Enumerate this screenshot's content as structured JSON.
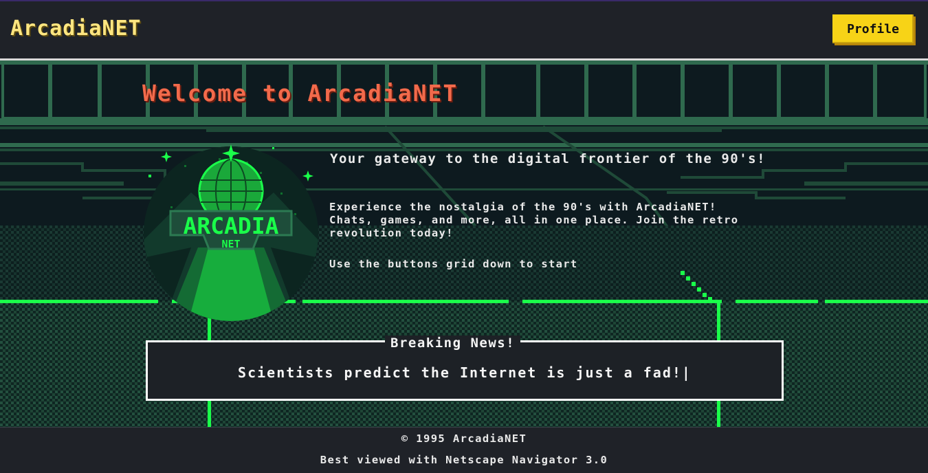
{
  "header": {
    "brand": "ArcadiaNET",
    "profile_label": "Profile"
  },
  "hero": {
    "title": "Welcome to ArcadiaNET",
    "logo_text": "ARCADIA",
    "logo_subtext": "NET",
    "tagline": "Your gateway to the digital frontier of the 90's!",
    "description": "Experience the nostalgia of the 90's with ArcadiaNET! Chats, games, and more, all in one place. Join the retro revolution today!",
    "hint": "Use the buttons grid down to start"
  },
  "news": {
    "title": "Breaking News!",
    "text": "Scientists predict the Internet is just a fad!|"
  },
  "footer": {
    "copyright": "© 1995 ArcadiaNET",
    "best_viewed": "Best viewed with Netscape Navigator 3.0"
  },
  "colors": {
    "brand_yellow": "#ffe680",
    "button_yellow": "#f7d317",
    "title_red": "#f26a4b",
    "neon_green": "#1aff4a",
    "grid_green": "#1f5a3c"
  },
  "icons": {
    "logo": "arcadia-globe-logo"
  }
}
